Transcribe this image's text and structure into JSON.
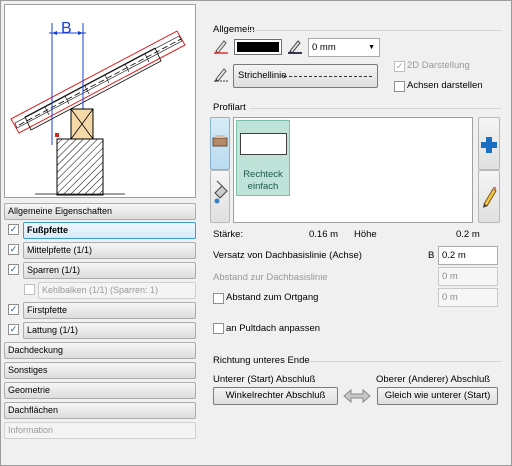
{
  "preview": {
    "label": "B"
  },
  "nav": {
    "general": "Allgemeine Eigenschaften",
    "items": [
      {
        "label": "Fußpfette"
      },
      {
        "label": "Mittelpfette (1/1)"
      },
      {
        "label": "Sparren (1/1)"
      },
      {
        "label": "Kehlbalken (1/1) (Sparren: 1)"
      },
      {
        "label": "Firstpfette"
      },
      {
        "label": "Lattung (1/1)"
      }
    ],
    "sections": [
      "Dachdeckung",
      "Sonstiges",
      "Geometrie",
      "Dachflächen",
      "Information"
    ]
  },
  "general": {
    "title": "Allgemein",
    "thickness_value": "0 mm",
    "linestyle_label": "Strichellinie",
    "opt_2d": "2D Darstellung",
    "opt_axes": "Achsen darstellen"
  },
  "profile": {
    "title": "Profilart",
    "item_label": "Rechteck einfach",
    "thickness_label": "Stärke:",
    "thickness_value": "0.16 m",
    "height_label": "Höhe",
    "height_value": "0.2 m",
    "offset_label": "Versatz von Dachbasislinie (Achse)",
    "offset_letter": "B",
    "offset_value": "0.2 m",
    "distance_roof_label": "Abstand zur Dachbasislinie",
    "distance_roof_value": "0 m",
    "distance_ridge_label": "Abstand zum Ortgang",
    "distance_ridge_value": "0 m",
    "adapt_label": "an Pultdach anpassen"
  },
  "direction": {
    "title": "Richtung unteres Ende",
    "lower_label": "Unterer (Start) Abschluß",
    "upper_label": "Oberer (Anderer) Abschluß",
    "lower_btn": "Winkelrechter Abschluß",
    "upper_btn": "Gleich wie unterer (Start)"
  },
  "colors": {
    "selected_border": "#3c9ad8",
    "profile_tile": "#bfe3d8",
    "accent_plus": "#1a6fc0"
  }
}
